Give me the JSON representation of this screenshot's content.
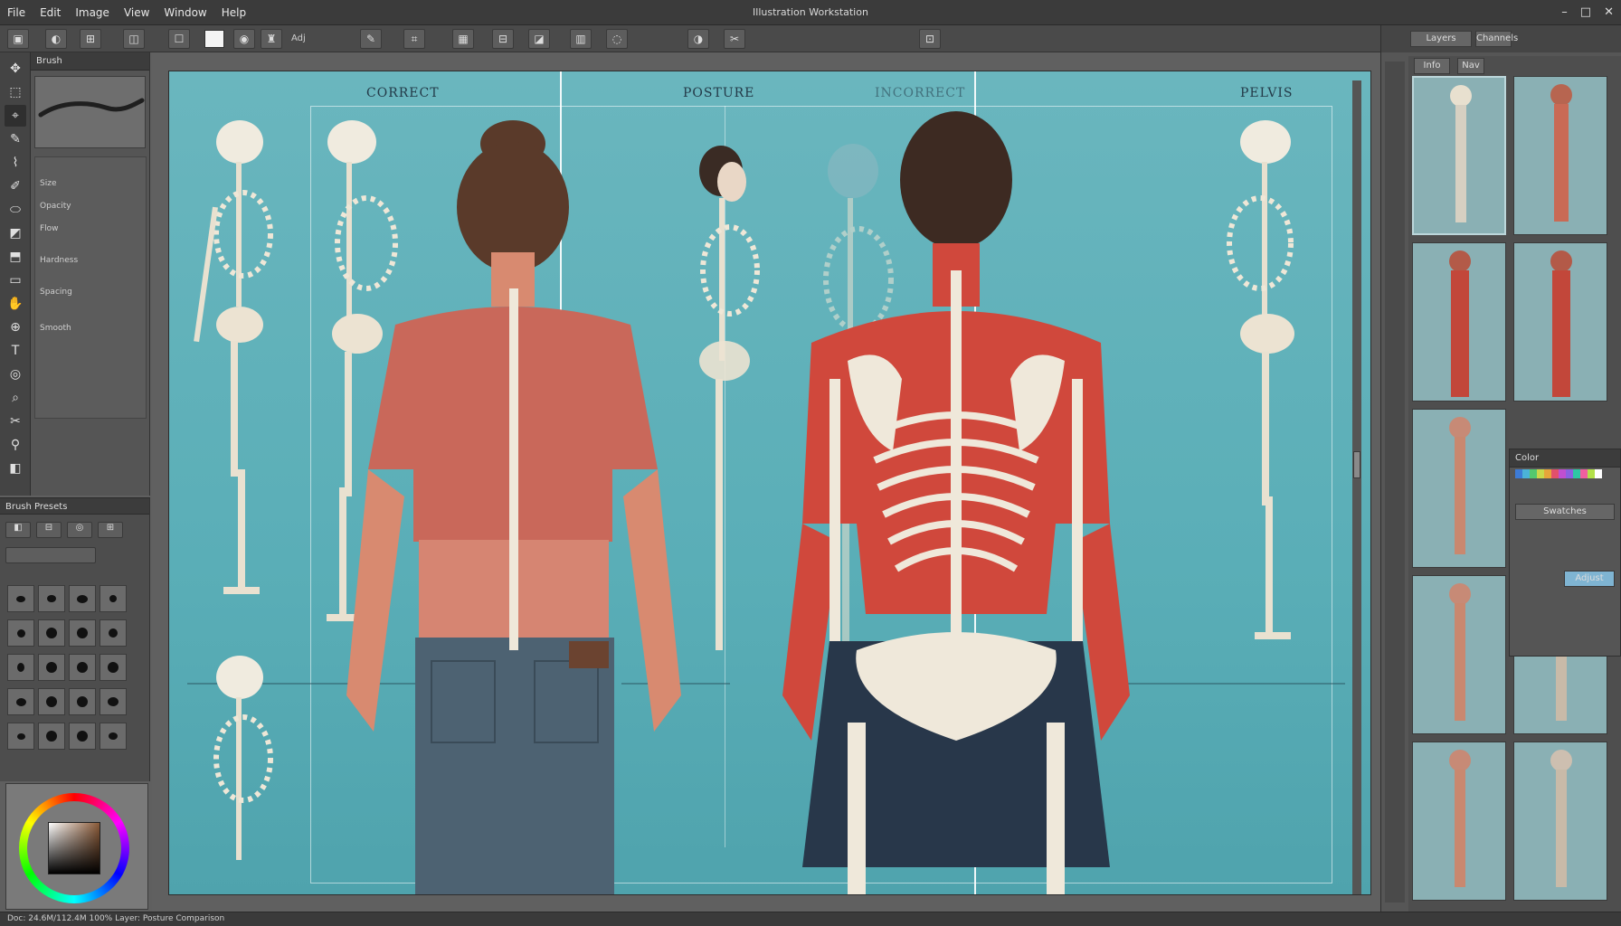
{
  "app": {
    "title": "Illustration Workstation"
  },
  "menubar": {
    "items": [
      "File",
      "Edit",
      "Image",
      "View",
      "Window",
      "Help"
    ],
    "window_buttons": [
      "–",
      "□",
      "✕"
    ]
  },
  "toolbar": {
    "tool_labels": [
      "▣",
      "◐",
      "⊞",
      "◫",
      "☐",
      "◉",
      "♜",
      "Adj",
      "✎",
      "⌗",
      "▦",
      "⊟",
      "◪",
      "▥",
      "◌",
      "◑",
      "✂",
      "⊡"
    ]
  },
  "tools": [
    "✥",
    "⬚",
    "⌖",
    "✎",
    "⌇",
    "✐",
    "⬭",
    "◩",
    "⬒",
    "▭",
    "✋",
    "⊕",
    "T",
    "◎",
    "⌕",
    "✂",
    "⚲",
    "◧"
  ],
  "left_panel": {
    "header": "Brush",
    "props": [
      "Size",
      "Opacity",
      "Flow",
      "Hardness",
      "Spacing",
      "Smooth"
    ]
  },
  "brush_panel": {
    "header": "Brush Presets",
    "chips": [
      "◧",
      "⊟",
      "◎",
      "⊞"
    ]
  },
  "canvas": {
    "labels": {
      "left": "CORRECT",
      "middle": "POSTURE",
      "middle2": "INCORRECT",
      "right": "PELVIS"
    }
  },
  "right_panel": {
    "tabs": [
      "Layers",
      "Channels"
    ],
    "sub_tabs": [
      "Info",
      "Nav"
    ],
    "float_items": [
      "Color",
      "Swatches",
      "Adjust"
    ]
  },
  "status": {
    "text": "Doc: 24.6M/112.4M     100%     Layer: Posture Comparison"
  },
  "colors": {
    "artboard": "#5aaeb7",
    "shirt": "#c9685a",
    "jeans": "#4d6272",
    "skin": "#d88a70",
    "muscle": "#d0483c",
    "bone": "#efe8da",
    "hair": "#5a3a2a"
  }
}
